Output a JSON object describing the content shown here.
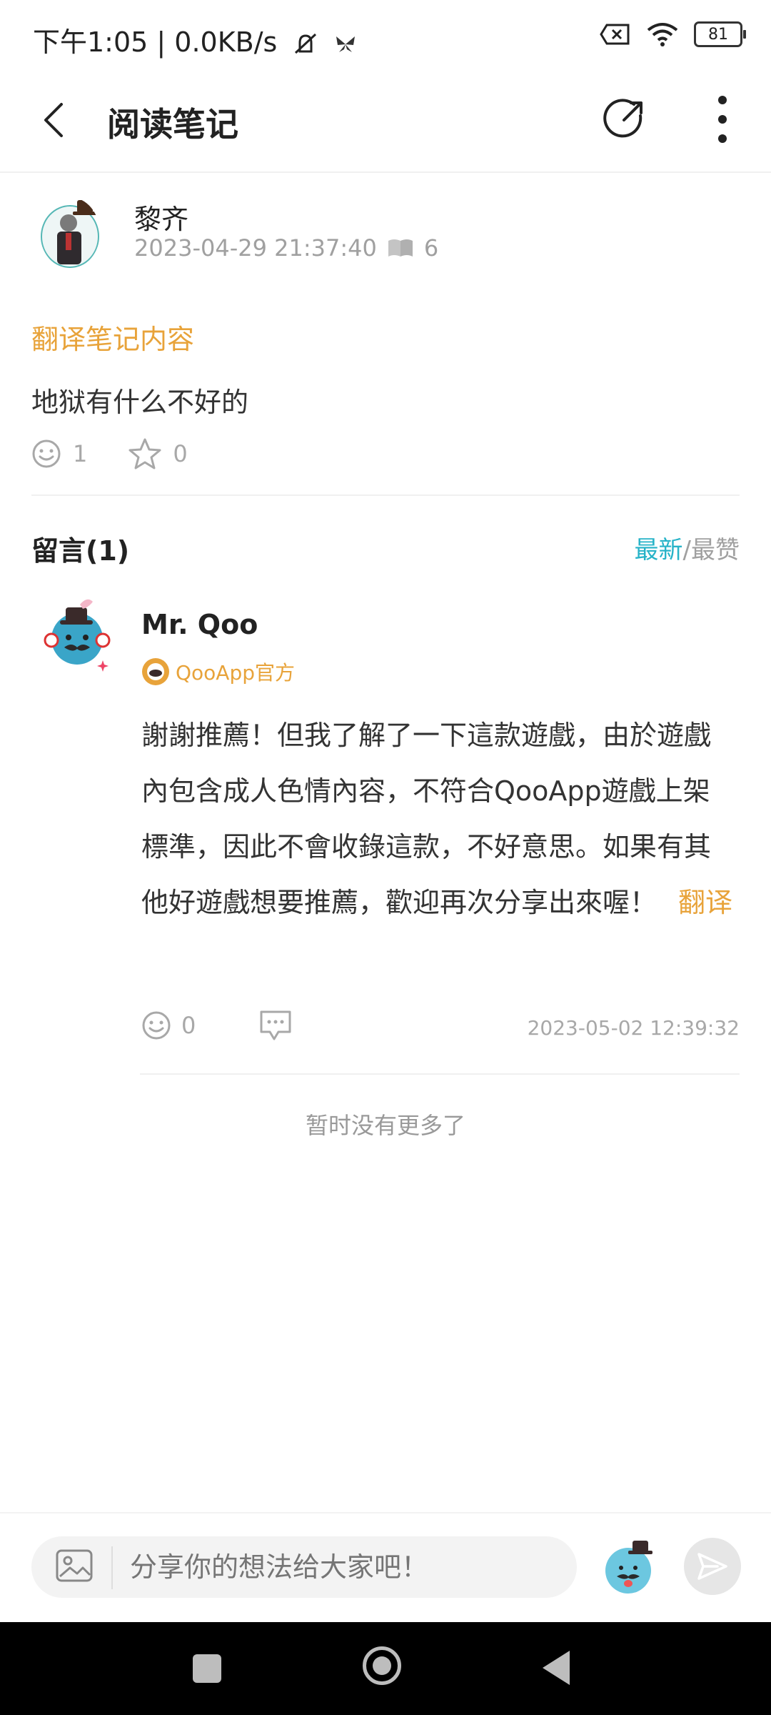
{
  "status": {
    "left_text": "下午1:05 | 0.0KB/s",
    "battery": "81",
    "icons": [
      "mute-icon",
      "butterfly-icon",
      "sim-off-icon",
      "wifi-icon",
      "battery-icon"
    ]
  },
  "header": {
    "title": "阅读笔记",
    "icons": [
      "back-icon",
      "share-icon",
      "more-icon"
    ]
  },
  "note": {
    "author": "黎齐",
    "datetime": "2023-04-29 21:37:40",
    "read_count": "6",
    "translate_label": "翻译笔记内容",
    "content": "地狱有什么不好的",
    "like_count": "1",
    "fav_count": "0"
  },
  "comments": {
    "title": "留言(1)",
    "sort_active": "最新",
    "sort_sep": "/",
    "sort_other": "最赞",
    "items": [
      {
        "name": "Mr. Qoo",
        "badge": "QooApp官方",
        "text": "謝謝推薦！但我了解了一下這款遊戲，由於遊戲內包含成人色情內容，不符合QooApp遊戲上架標準，因此不會收錄這款，不好意思。如果有其他好遊戲想要推薦，歡迎再次分享出來喔！",
        "translate": "翻译",
        "like_count": "0",
        "time": "2023-05-02 12:39:32"
      }
    ],
    "no_more": "暂时没有更多了"
  },
  "input": {
    "placeholder": "分享你的想法给大家吧！"
  },
  "colors": {
    "accent_orange": "#e8a33a",
    "accent_teal": "#27b3c8",
    "muted": "#a0a0a0"
  }
}
